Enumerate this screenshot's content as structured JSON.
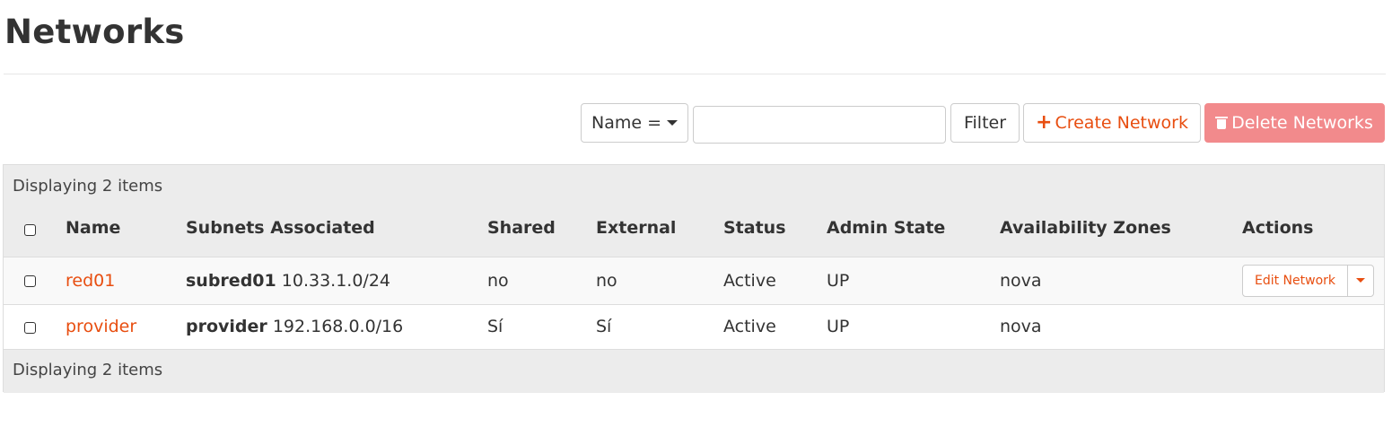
{
  "page": {
    "title": "Networks"
  },
  "toolbar": {
    "filter_field_label": "Name =",
    "filter_input_value": "",
    "filter_button": "Filter",
    "create_button": "Create Network",
    "create_icon": "plus-icon",
    "delete_button": "Delete Networks",
    "delete_icon": "trash-icon"
  },
  "table": {
    "summary_top": "Displaying 2 items",
    "summary_bottom": "Displaying 2 items",
    "columns": {
      "name": "Name",
      "subnets": "Subnets Associated",
      "shared": "Shared",
      "external": "External",
      "status": "Status",
      "admin_state": "Admin State",
      "zones": "Availability Zones",
      "actions": "Actions"
    },
    "rows": [
      {
        "name": "red01",
        "subnet_name": "subred01",
        "subnet_cidr": "10.33.1.0/24",
        "shared": "no",
        "external": "no",
        "status": "Active",
        "admin_state": "UP",
        "zones": "nova",
        "action_label": "Edit Network"
      },
      {
        "name": "provider",
        "subnet_name": "provider",
        "subnet_cidr": "192.168.0.0/16",
        "shared": "Sí",
        "external": "Sí",
        "status": "Active",
        "admin_state": "UP",
        "zones": "nova"
      }
    ]
  },
  "colors": {
    "accent": "#e84e10",
    "danger_button": "#f28a8c",
    "header_bg": "#ececec"
  }
}
